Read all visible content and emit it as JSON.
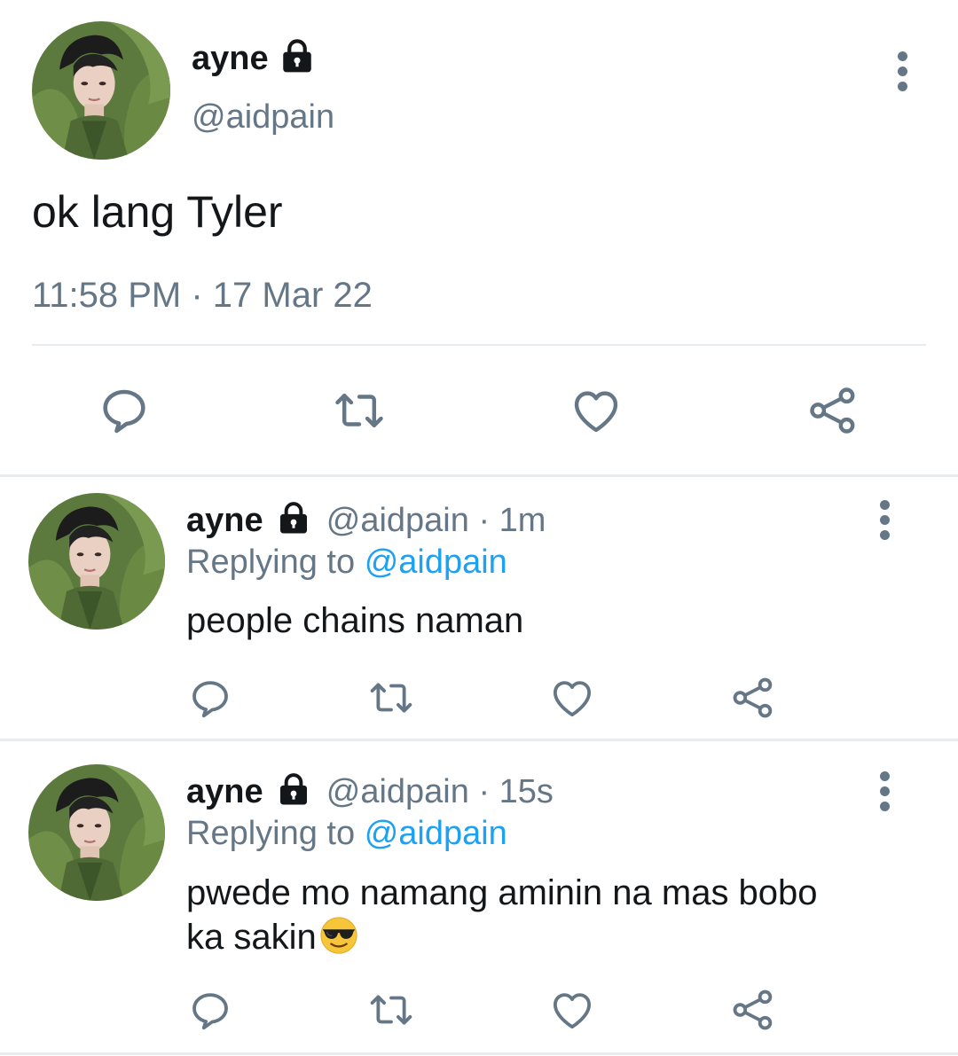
{
  "main_tweet": {
    "display_name": "ayne",
    "handle": "@aidpain",
    "text": "ok lang Tyler",
    "timestamp": "11:58 PM · 17 Mar 22",
    "protected": true
  },
  "replies": [
    {
      "display_name": "ayne",
      "handle": "@aidpain",
      "time": "· 1m",
      "replying_prefix": "Replying to",
      "replying_to": "@aidpain",
      "text": "people chains naman"
    },
    {
      "display_name": "ayne",
      "handle": "@aidpain",
      "time": "· 15s",
      "replying_prefix": "Replying to",
      "replying_to": "@aidpain",
      "text_line1": "pwede mo namang aminin na mas bobo",
      "text_line2": "ka sakin",
      "emoji": "smiling-face-with-sunglasses"
    }
  ],
  "icons": {
    "reply": "reply-icon",
    "retweet": "retweet-icon",
    "like": "like-icon",
    "share": "share-icon",
    "lock": "lock-icon",
    "more": "more-options-icon"
  },
  "colors": {
    "text": "#14171a",
    "secondary": "#657786",
    "link": "#1da1f2",
    "divider": "#e6ecf0"
  }
}
